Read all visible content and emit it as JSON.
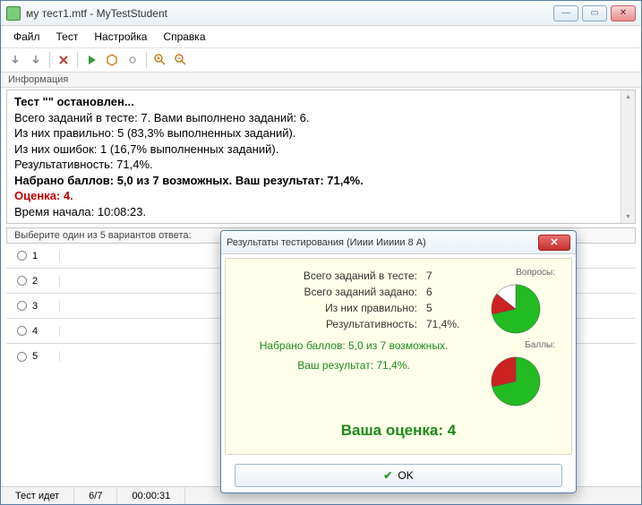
{
  "window": {
    "title": "му тест1.mtf - MyTestStudent"
  },
  "menu": {
    "file": "Файл",
    "test": "Тест",
    "settings": "Настройка",
    "help": "Справка"
  },
  "toolbar_icons": {
    "i0": "down-arrow-icon",
    "i1": "down-arrow2-icon",
    "i2": "cancel-icon",
    "i3": "play-icon",
    "i4": "stop-icon",
    "i5": "record-icon",
    "i6": "zoom-in-icon",
    "i7": "zoom-out-icon"
  },
  "group_label": "Информация",
  "info": {
    "l0": "Тест \"\" остановлен...",
    "l1": "Всего заданий в тесте: 7. Вами выполнено заданий: 6.",
    "l2": "Из них правильно: 5 (83,3% выполненных заданий).",
    "l3": "Из них ошибок: 1 (16,7% выполненных заданий).",
    "l4": "Результативность: 71,4%.",
    "l5": "Набрано баллов: 5,0 из 7 возможных. Ваш результат: 71,4%.",
    "l6": "Оценка: 4.",
    "l7": "Время начала: 10:08:23."
  },
  "choices_label": "Выберите один из 5 вариантов ответа:",
  "options": [
    "1",
    "2",
    "3",
    "4",
    "5"
  ],
  "status": {
    "state": "Тест идет",
    "progress": "6/7",
    "time": "00:00:31"
  },
  "dialog": {
    "title": "Результаты тестирования (Ииии Иииии 8 А)",
    "stats": {
      "total_label": "Всего заданий в тесте:",
      "total_val": "7",
      "asked_label": "Всего заданий задано:",
      "asked_val": "6",
      "correct_label": "Из них правильно:",
      "correct_val": "5",
      "perf_label": "Результативность:",
      "perf_val": "71,4%."
    },
    "pies": {
      "questions_label": "Вопросы:",
      "points_label": "Баллы:"
    },
    "score1": "Набрано баллов: 5,0 из 7 возможных.",
    "score2": "Ваш результат: 71,4%.",
    "grade": "Ваша оценка: 4",
    "ok": "OK"
  },
  "chart_data": [
    {
      "type": "pie",
      "title": "Вопросы",
      "categories": [
        "Правильно",
        "Ошибки",
        "Не задано"
      ],
      "values": [
        5,
        1,
        1
      ],
      "colors": [
        "#22bb22",
        "#cc2222",
        "#ffffff"
      ]
    },
    {
      "type": "pie",
      "title": "Баллы",
      "categories": [
        "Набрано",
        "Не набрано"
      ],
      "values": [
        5,
        2
      ],
      "colors": [
        "#22bb22",
        "#cc2222"
      ]
    }
  ]
}
